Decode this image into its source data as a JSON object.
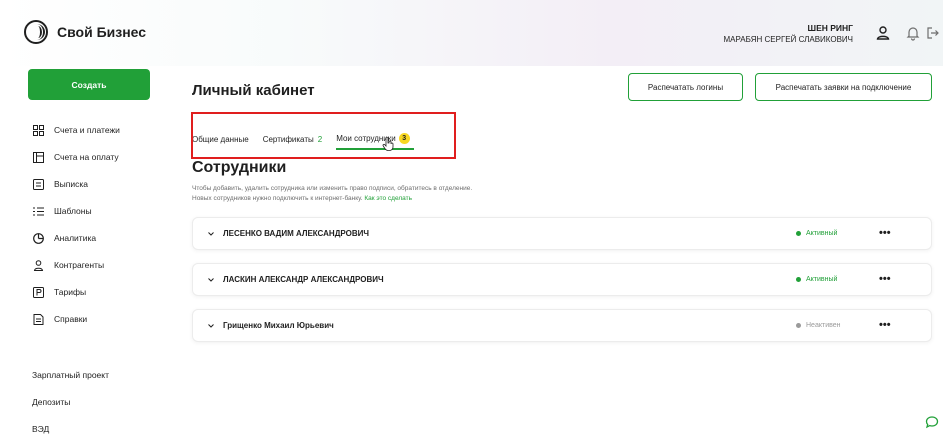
{
  "header": {
    "brand": "Свой Бизнес",
    "org_name": "ШЕН РИНГ",
    "user_name": "МАРАБЯН СЕРГЕЙ СЛАВИКОВИЧ",
    "icons": [
      "user-icon",
      "bell-icon",
      "logout-icon"
    ]
  },
  "sidebar": {
    "create_label": "Создать",
    "items": [
      {
        "label": "Счета и платежи",
        "icon": "grid-icon"
      },
      {
        "label": "Счета на оплату",
        "icon": "invoice-icon"
      },
      {
        "label": "Выписка",
        "icon": "statement-icon"
      },
      {
        "label": "Шаблоны",
        "icon": "list-icon"
      },
      {
        "label": "Аналитика",
        "icon": "analytics-icon"
      },
      {
        "label": "Контрагенты",
        "icon": "person-icon"
      },
      {
        "label": "Тарифы",
        "icon": "tariff-icon"
      },
      {
        "label": "Справки",
        "icon": "document-icon"
      }
    ],
    "extra": [
      "Зарплатный проект",
      "Депозиты",
      "ВЭД"
    ]
  },
  "main": {
    "title": "Личный кабинет",
    "buttons": {
      "print_logins": "Распечатать логины",
      "print_requests": "Распечатать заявки на подключение"
    },
    "tabs": [
      {
        "label": "Общие данные"
      },
      {
        "label": "Сертификаты",
        "count": "2"
      },
      {
        "label": "Мои сотрудники",
        "badge": "3",
        "active": true
      }
    ],
    "section_title": "Сотрудники",
    "desc_line1": "Чтобы добавить, удалить сотрудника или изменить право подписи, обратитесь в отделение.",
    "desc_line2": "Новых сотрудников нужно подключить к интернет-банку.",
    "desc_link": "Как это сделать",
    "employees": [
      {
        "name": "ЛЕСЕНКО ВАДИМ АЛЕКСАНДРОВИЧ",
        "status": "Активный",
        "status_color": "#21a038"
      },
      {
        "name": "ЛАСКИН АЛЕКСАНДР АЛЕКСАНДРОВИЧ",
        "status": "Активный",
        "status_color": "#21a038"
      },
      {
        "name": "Грищенко Михаил Юрьевич",
        "status": "Неактивен",
        "status_color": "#9a9a9a"
      }
    ],
    "more_symbol": "•••"
  },
  "colors": {
    "accent": "#21a038",
    "badge": "#f7d723",
    "highlight": "#e01e1e"
  }
}
